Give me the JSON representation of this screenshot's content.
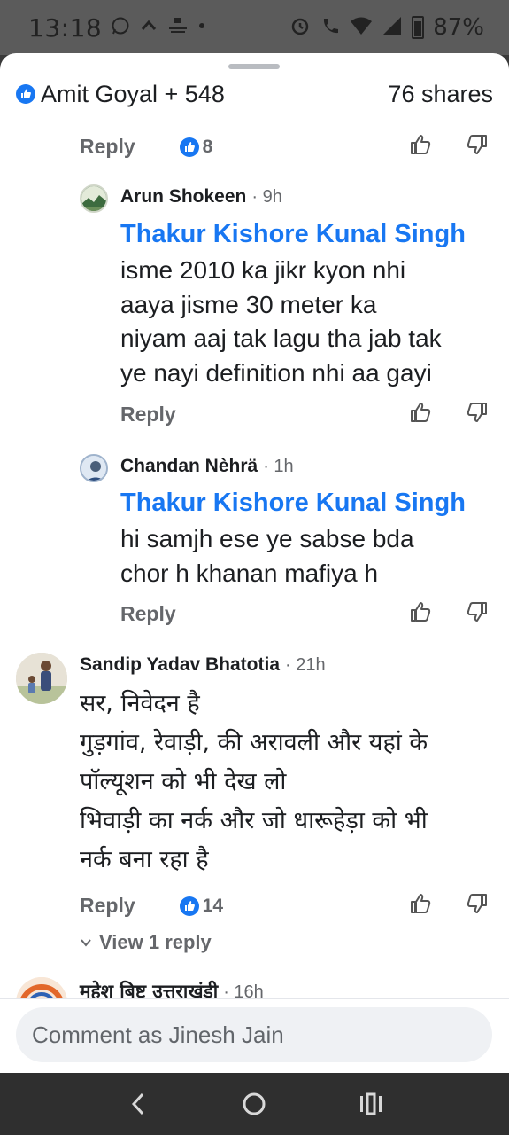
{
  "status_bar": {
    "time": "13:18",
    "battery": "87%"
  },
  "header": {
    "reactors": "Amit Goyal + 548",
    "shares": "76 shares"
  },
  "top_comment_actions": {
    "reply_label": "Reply",
    "like_count": "8"
  },
  "comments": [
    {
      "author": "Arun Shokeen",
      "time": "· 9h",
      "mention": "Thakur Kishore Kunal Singh",
      "text": "isme 2010 ka jikr kyon nhi\naaya jisme 30 meter ka\nniyam aaj tak lagu tha jab tak\nye nayi definition nhi aa gayi",
      "reply_label": "Reply"
    },
    {
      "author": "Chandan Nèhrä",
      "time": "· 1h",
      "mention": "Thakur Kishore Kunal Singh",
      "text": "hi samjh ese ye sabse bda\nchor h khanan mafiya h",
      "reply_label": "Reply"
    },
    {
      "author": "Sandip Yadav Bhatotia",
      "time": "· 21h",
      "text": "सर, निवेदन है\nगुड़गांव, रेवाड़ी, की अरावली और यहां के\nपॉल्यूशन को भी देख लो\nभिवाड़ी का नर्क और जो धारूहेड़ा को भी\nनर्क बना रहा है",
      "reply_label": "Reply",
      "like_count": "14",
      "view_replies": "View 1 reply"
    },
    {
      "author": "महेश बिष्ट उत्तराखंडी",
      "time": "· 16h"
    }
  ],
  "composer": {
    "placeholder": "Comment as Jinesh Jain"
  },
  "colors": {
    "accent": "#1877f2",
    "muted": "#65676b"
  }
}
